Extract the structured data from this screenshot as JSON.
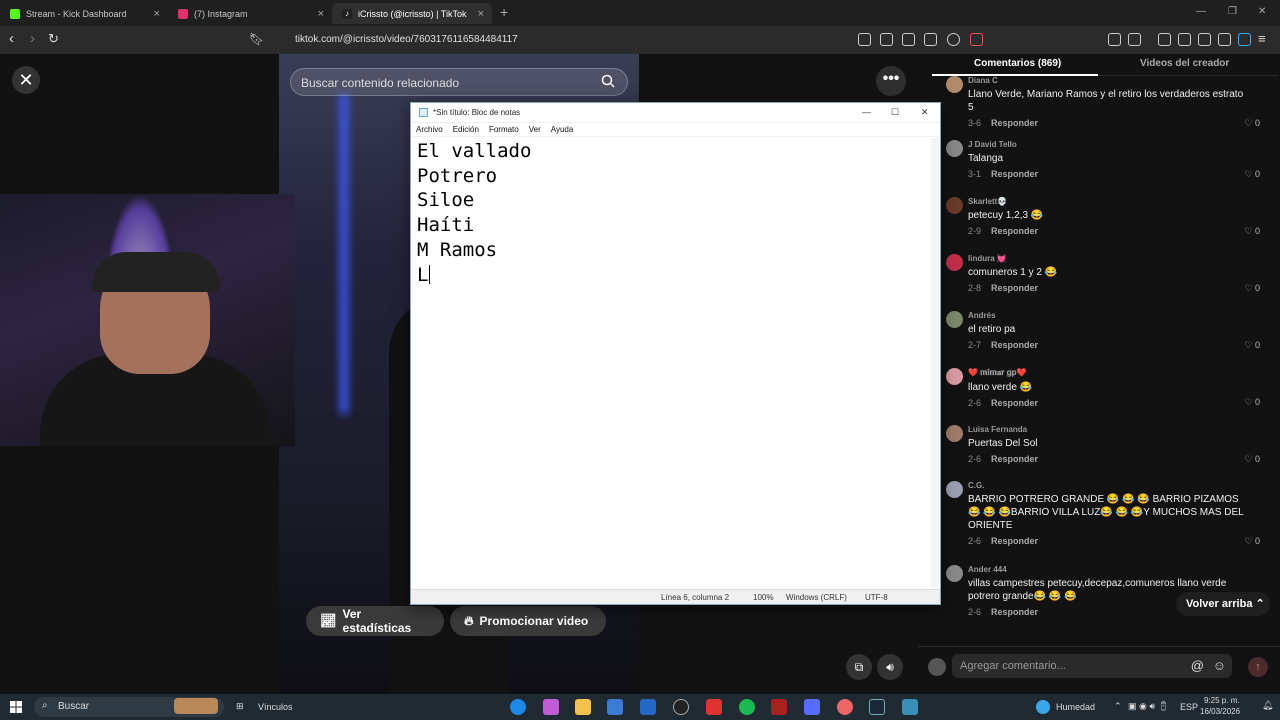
{
  "browser": {
    "tabs": [
      {
        "label": "Stream - Kick Dashboard",
        "color": "#53fc18"
      },
      {
        "label": "(7) Instagram",
        "color": "#e1306c"
      },
      {
        "label": "iCrissto (@icrissto) | TikTok",
        "color": "#ffffff"
      }
    ],
    "new_tab_icon": "plus-icon",
    "url": "tiktok.com/@icrissto/video/7603176116584484117"
  },
  "video_page": {
    "search_placeholder": "Buscar contenido relacionado",
    "stats_button": "Ver estadísticas",
    "promote_button": "Promocionar video"
  },
  "notepad": {
    "title": "*Sin título: Bloc de notas",
    "menu": [
      "Archivo",
      "Edición",
      "Formato",
      "Ver",
      "Ayuda"
    ],
    "lines": [
      "El vallado",
      "Potrero",
      "Siloe",
      "Haíti",
      "M Ramos",
      "L"
    ],
    "status": {
      "position": "Línea 6, columna 2",
      "zoom": "100%",
      "line_ending": "Windows (CRLF)",
      "encoding": "UTF-8"
    }
  },
  "comments_panel": {
    "tabs": [
      "Comentarios (869)",
      "Videos del creador"
    ],
    "reply_label": "Responder",
    "comments": [
      {
        "author": "Diana C",
        "text": "Llano Verde, Mariano Ramos y el retiro los verdaderos estrato 5",
        "date": "3-6",
        "likes": "0",
        "avatar": "#b08a6a"
      },
      {
        "author": "J David Tello",
        "text": "Talanga",
        "date": "3-1",
        "likes": "0",
        "avatar": "#888888"
      },
      {
        "author": "Skarlett💀",
        "text": "petecuy 1,2,3 😂",
        "date": "2-9",
        "likes": "0",
        "avatar": "#6a3a2a"
      },
      {
        "author": "lindura 💓",
        "text": "comuneros 1 y 2 😂",
        "date": "2-8",
        "likes": "0",
        "avatar": "#c0304a"
      },
      {
        "author": "Andrés",
        "text": "el retiro pa",
        "date": "2-7",
        "likes": "0",
        "avatar": "#7a8a6a"
      },
      {
        "author": "❤️ 𝐦𝐢𝐦𝐚𝐫 𝐠𝐩❤️",
        "text": "llano verde 😂",
        "date": "2-6",
        "likes": "0",
        "avatar": "#d89aa0"
      },
      {
        "author": "Luisa Fernanda",
        "text": "Puertas Del Sol",
        "date": "2-6",
        "likes": "0",
        "avatar": "#a07a6a"
      },
      {
        "author": "C.G.",
        "text": "BARRIO POTRERO GRANDE 😂 😂 😂 BARRIO PIZAMOS😂 😂 😂BARRIO VILLA LUZ😂 😂 😂Y MUCHOS MAS DEL ORIENTE",
        "date": "2-6",
        "likes": "0",
        "avatar": "#9aa0b0"
      },
      {
        "author": "Ander 444",
        "text": "villas campestres petecuy,decepaz,comuneros llano verde potrero grande😂 😂 😂",
        "date": "2-6",
        "likes": "0",
        "avatar": "#8a8a8a"
      }
    ],
    "back_to_top": "Volver arriba",
    "comment_placeholder": "Agregar comentario..."
  },
  "taskbar": {
    "search_label": "Buscar",
    "links_label": "Vínculos",
    "weather": "Humedad",
    "language": "ESP",
    "time": "9:25 p. m.",
    "date": "16/03/2026"
  }
}
